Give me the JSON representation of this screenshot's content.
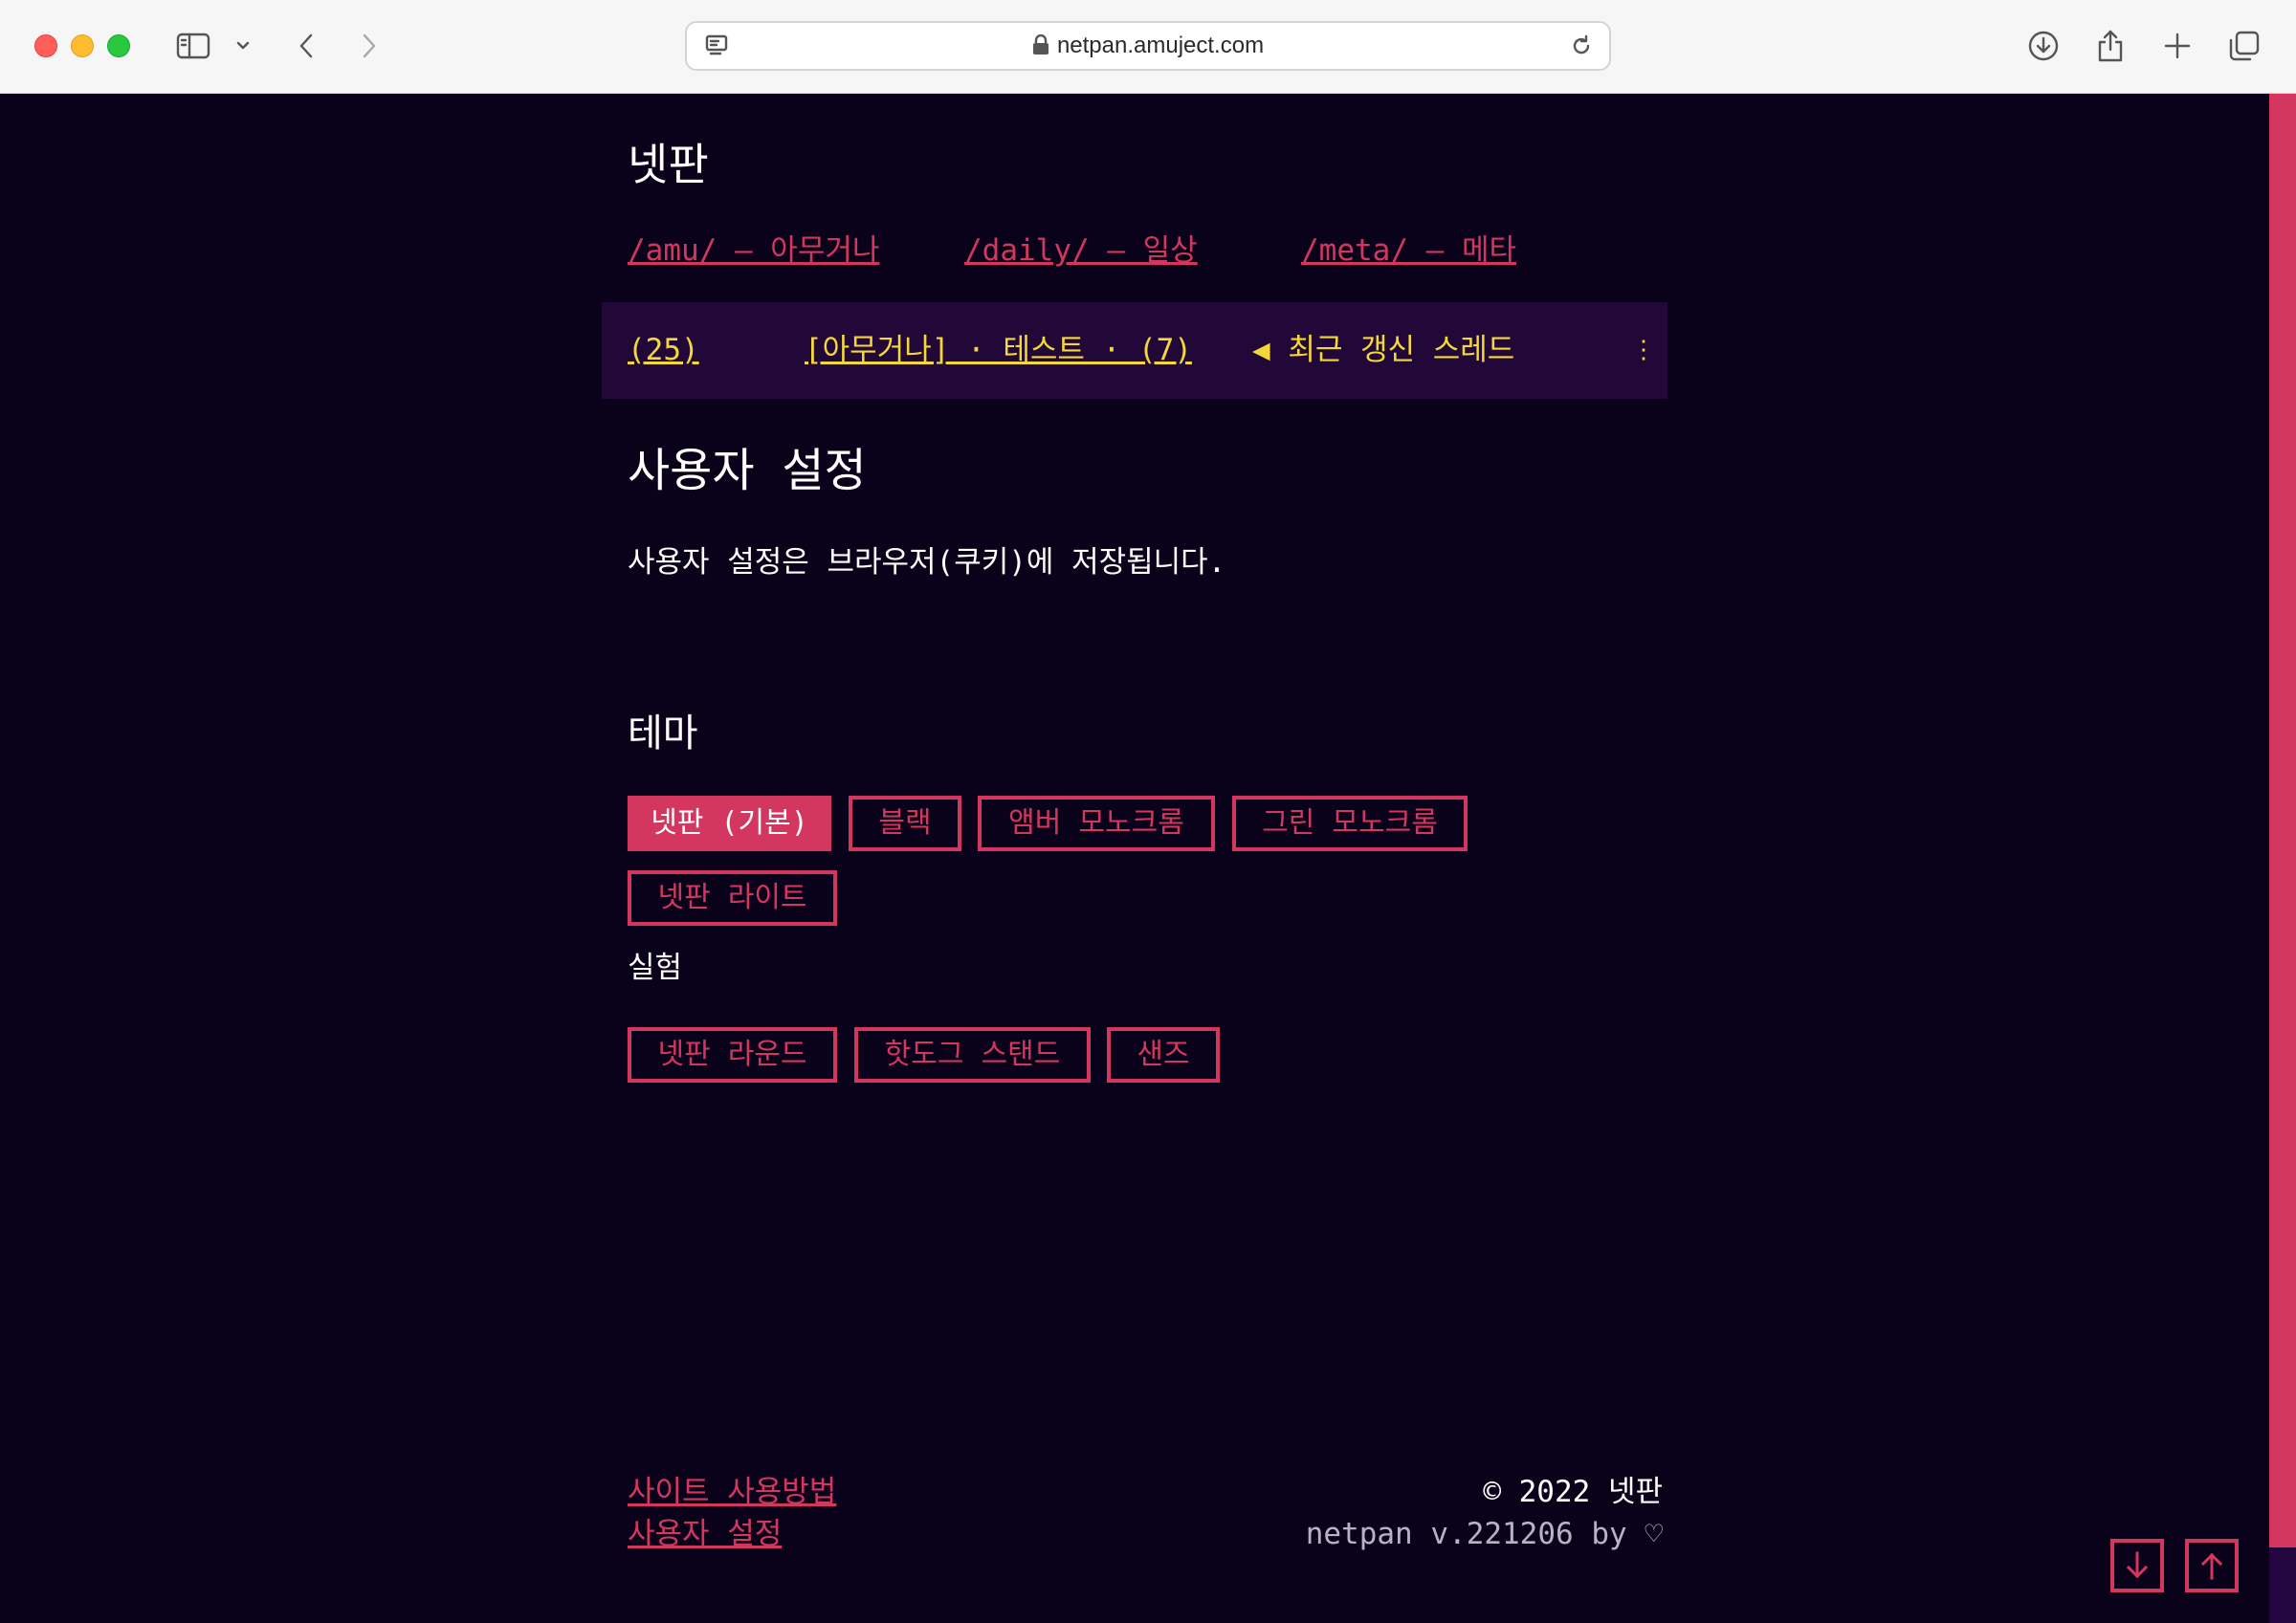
{
  "browser": {
    "url": "netpan.amuject.com",
    "icons": [
      "sidebar-icon",
      "chevron-down-icon",
      "back-icon",
      "forward-icon",
      "reader-icon",
      "lock-icon",
      "reload-icon",
      "download-icon",
      "share-icon",
      "new-tab-icon",
      "tab-overview-icon"
    ]
  },
  "site": {
    "title": "넷판",
    "boards": [
      {
        "label": "/amu/ — 아무거나"
      },
      {
        "label": "/daily/ — 일상"
      },
      {
        "label": "/meta/ — 메타"
      }
    ]
  },
  "ticker": {
    "count": "(25)",
    "thread": "[아무거나] · 테스트 · (7)",
    "recent": "◀ 최근 갱신 스레드",
    "more": "⋮"
  },
  "settings": {
    "heading": "사용자 설정",
    "description": "사용자 설정은 브라우저(쿠키)에 저장됩니다.",
    "theme_heading": "테마",
    "themes": [
      "넷판 (기본)",
      "블랙",
      "앰버 모노크롬",
      "그린 모노크롬",
      "넷판 라이트"
    ],
    "active_theme": "넷판 (기본)",
    "experimental_heading": "실험",
    "experimental": [
      "넷판 라운드",
      "핫도그 스탠드",
      "샌즈"
    ]
  },
  "footer": {
    "links": [
      "사이트 사용방법",
      "사용자 설정"
    ],
    "copyright": "© 2022 넷판",
    "version": "netpan v.221206 by ♡"
  },
  "colors": {
    "background": "#0a021a",
    "accent": "#d3375f",
    "ticker_bg": "#220838",
    "ticker_text": "#f4d83a"
  }
}
